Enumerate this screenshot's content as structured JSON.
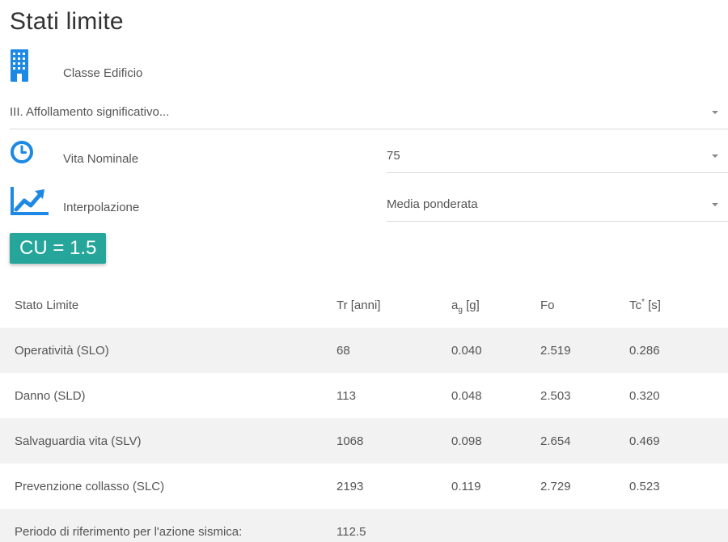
{
  "page": {
    "title": "Stati limite"
  },
  "classe_edificio": {
    "label": "Classe Edificio",
    "icon": "building-icon",
    "selected": "III. Affollamento significativo..."
  },
  "vita_nominale": {
    "label": "Vita Nominale",
    "icon": "clock-icon",
    "selected": "75"
  },
  "interpolazione": {
    "label": "Interpolazione",
    "icon": "trend-chart-icon",
    "selected": "Media ponderata"
  },
  "cu_badge": {
    "text": "CU = 1.5",
    "color": "#26a69a"
  },
  "table": {
    "headers": {
      "stato": "Stato Limite",
      "tr": "Tr [anni]",
      "ag_main": "a",
      "ag_sub": "g",
      "ag_unit": " [g]",
      "fo": "Fo",
      "tc_main": "Tc",
      "tc_sup": "*",
      "tc_unit": " [s]"
    },
    "rows": [
      {
        "name": "Operatività (SLO)",
        "tr": "68",
        "ag": "0.040",
        "fo": "2.519",
        "tc": "0.286"
      },
      {
        "name": "Danno (SLD)",
        "tr": "113",
        "ag": "0.048",
        "fo": "2.503",
        "tc": "0.320"
      },
      {
        "name": "Salvaguardia vita (SLV)",
        "tr": "1068",
        "ag": "0.098",
        "fo": "2.654",
        "tc": "0.469"
      },
      {
        "name": "Prevenzione collasso (SLC)",
        "tr": "2193",
        "ag": "0.119",
        "fo": "2.729",
        "tc": "0.523"
      }
    ],
    "footer": {
      "label": "Periodo di riferimento per l'azione sismica:",
      "value": "112.5"
    }
  },
  "colors": {
    "icon_blue": "#1e88e5",
    "row_shade": "#f2f2f2"
  }
}
